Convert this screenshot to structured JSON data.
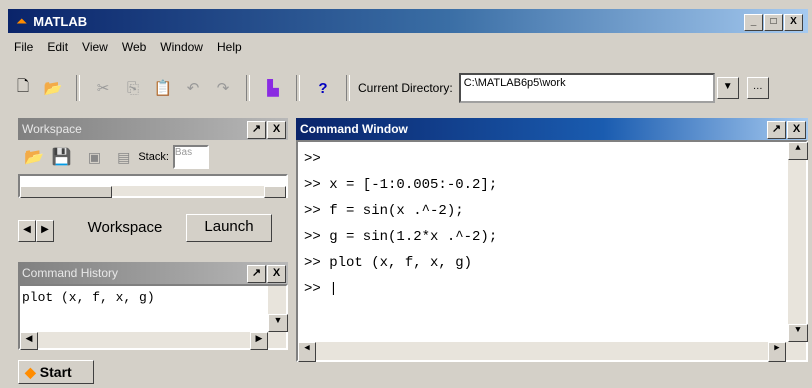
{
  "window": {
    "title": "MATLAB",
    "controls": [
      "_",
      "□",
      "X"
    ]
  },
  "menu": [
    "File",
    "Edit",
    "View",
    "Web",
    "Window",
    "Help"
  ],
  "toolbar": {
    "current_dir_label": "Current Directory:",
    "current_dir_value": "C:\\MATLAB6p5\\work",
    "help_label": "?"
  },
  "workspace": {
    "title": "Workspace",
    "stack_label": "Stack:",
    "stack_value": "Bas",
    "tabs": [
      "Workspace",
      "Launch"
    ]
  },
  "history": {
    "title": "Command History",
    "entries": [
      "plot (x, f, x, g)"
    ]
  },
  "command": {
    "title": "Command Window",
    "lines": [
      ">>",
      ">> x = [-1:0.005:-0.2];",
      ">> f = sin(x .^-2);",
      ">> g = sin(1.2*x .^-2);",
      ">> plot (x, f, x, g)",
      ">> |"
    ]
  },
  "panel_buttons": {
    "undock": "↗",
    "close": "X"
  },
  "start": {
    "label": "Start"
  }
}
